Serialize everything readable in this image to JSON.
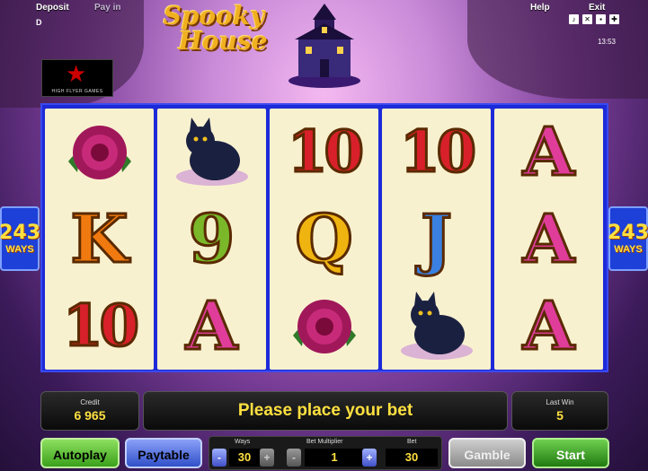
{
  "top_menu": {
    "deposit": "Deposit",
    "payin": "Pay in",
    "help": "Help",
    "exit": "Exit",
    "corner": "D"
  },
  "status": {
    "clock": "13:53",
    "icons": [
      "music-icon",
      "sound-off-icon",
      "settings-icon",
      "fullscreen-icon"
    ]
  },
  "logo": {
    "line1": "Spooky",
    "line2": "House",
    "partner_text": "HIGH FLYER GAMES"
  },
  "reels": [
    {
      "symbols": [
        {
          "type": "rose"
        },
        {
          "type": "letter",
          "text": "K",
          "color": "#f07a10"
        },
        {
          "type": "letter",
          "text": "10",
          "color": "#d8202a"
        }
      ]
    },
    {
      "symbols": [
        {
          "type": "cat"
        },
        {
          "type": "letter",
          "text": "9",
          "color": "#7ab82a"
        },
        {
          "type": "letter",
          "text": "A",
          "color": "#e03c9a"
        }
      ]
    },
    {
      "symbols": [
        {
          "type": "letter",
          "text": "10",
          "color": "#d8202a"
        },
        {
          "type": "letter",
          "text": "Q",
          "color": "#f0b410"
        },
        {
          "type": "rose"
        }
      ]
    },
    {
      "symbols": [
        {
          "type": "letter",
          "text": "10",
          "color": "#d8202a"
        },
        {
          "type": "letter",
          "text": "J",
          "color": "#3a80e0"
        },
        {
          "type": "cat"
        }
      ]
    },
    {
      "symbols": [
        {
          "type": "letter",
          "text": "A",
          "color": "#e03c9a"
        },
        {
          "type": "letter",
          "text": "A",
          "color": "#e03c9a"
        },
        {
          "type": "letter",
          "text": "A",
          "color": "#e03c9a"
        }
      ]
    }
  ],
  "ways_badge": {
    "number": "243",
    "label": "WAYS"
  },
  "credit": {
    "label": "Credit",
    "value": "6 965"
  },
  "message": "Please place your bet",
  "last_win": {
    "label": "Last Win",
    "value": "5"
  },
  "buttons": {
    "autoplay": "Autoplay",
    "paytable": "Paytable",
    "gamble": "Gamble",
    "start": "Start"
  },
  "bet": {
    "ways_label": "Ways",
    "ways_value": "30",
    "multiplier_label": "Bet Multiplier",
    "multiplier_value": "1",
    "bet_label": "Bet",
    "bet_value": "30",
    "minus": "-",
    "plus": "+"
  }
}
